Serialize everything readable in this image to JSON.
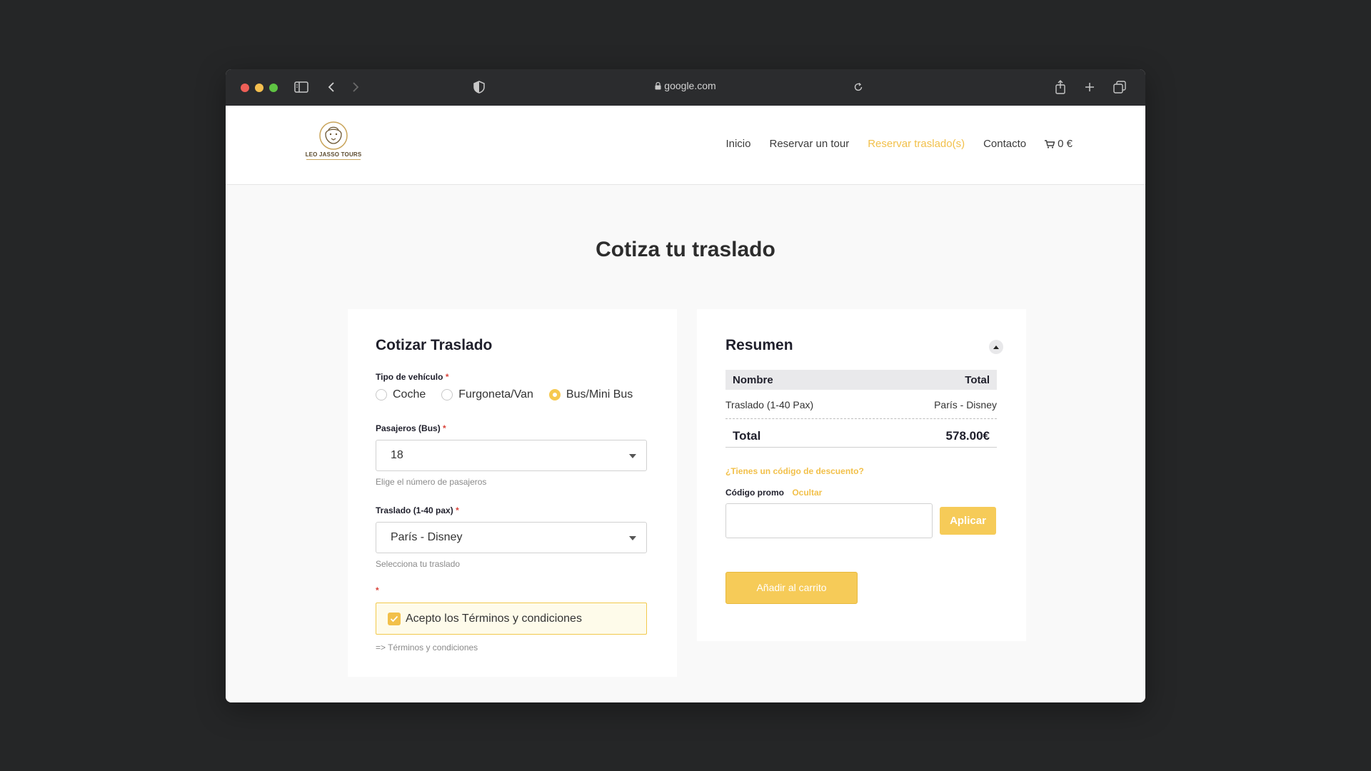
{
  "browser": {
    "url": "google.com"
  },
  "site": {
    "logo_text": "LEO JASSO TOURS",
    "nav": {
      "items": [
        "Inicio",
        "Reservar un tour",
        "Reservar traslado(s)",
        "Contacto"
      ],
      "active_index": 2,
      "cart_label": "0 €"
    },
    "page_title": "Cotiza tu traslado"
  },
  "form": {
    "title": "Cotizar Traslado",
    "vehicle_label": "Tipo de vehículo",
    "required_mark": "*",
    "vehicle_options": [
      "Coche",
      "Furgoneta/Van",
      "Bus/Mini Bus"
    ],
    "vehicle_selected": "Bus/Mini Bus",
    "passengers_label": "Pasajeros (Bus)",
    "passengers_value": "18",
    "passengers_hint": "Elige el número de pasajeros",
    "transfer_label": "Traslado (1-40 pax)",
    "transfer_value": "París - Disney",
    "transfer_hint": "Selecciona tu traslado",
    "terms_label": "Acepto los Términos y condiciones",
    "terms_checked": true,
    "terms_link": "=> Términos y condiciones"
  },
  "summary": {
    "title": "Resumen",
    "table_headers": [
      "Nombre",
      "Total"
    ],
    "rows": [
      {
        "name": "Traslado (1-40 Pax)",
        "total": "París - Disney"
      }
    ],
    "total_label": "Total",
    "total_value": "578.00€",
    "discount_link": "¿Tienes un código de descuento?",
    "promo_label": "Código promo",
    "promo_hide": "Ocultar",
    "promo_value": "",
    "apply_label": "Aplicar",
    "add_to_cart_label": "Añadir al carrito"
  },
  "colors": {
    "accent": "#f2c04a",
    "required": "#d9443b",
    "browser_chrome": "#2b2c2e"
  }
}
